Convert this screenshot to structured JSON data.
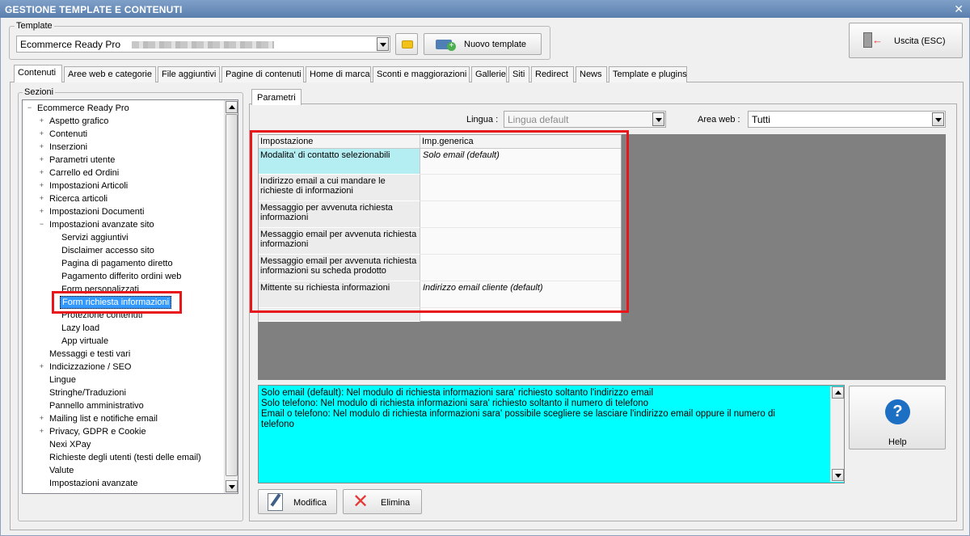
{
  "window": {
    "title": "GESTIONE TEMPLATE E CONTENUTI"
  },
  "template": {
    "group_label": "Template",
    "selected": "Ecommerce Ready Pro",
    "new_button": "Nuovo template"
  },
  "exit_button": "Uscita (ESC)",
  "tabs": [
    "Contenuti",
    "Aree web e categorie",
    "File aggiuntivi",
    "Pagine di contenuti",
    "Home di marca",
    "Sconti e maggiorazioni",
    "Gallerie",
    "Siti",
    "Redirect",
    "News",
    "Template e plugins"
  ],
  "sections": {
    "label": "Sezioni",
    "root": "Ecommerce Ready Pro",
    "items": [
      "Aspetto grafico",
      "Contenuti",
      "Inserzioni",
      "Parametri utente",
      "Carrello ed Ordini",
      "Impostazioni Articoli",
      "Ricerca articoli",
      "Impostazioni Documenti",
      "Impostazioni avanzate sito"
    ],
    "subitems": [
      "Servizi aggiuntivi",
      "Disclaimer accesso sito",
      "Pagina di pagamento diretto",
      "Pagamento differito ordini web",
      "Form personalizzati",
      "Form richiesta informazioni",
      "Protezione contenuti",
      "Lazy load",
      "App virtuale"
    ],
    "items_after": [
      "Messaggi e testi vari",
      "Indicizzazione / SEO",
      "Lingue",
      "Stringhe/Traduzioni",
      "Pannello amministrativo",
      "Mailing list e notifiche email",
      "Privacy, GDPR e Cookie",
      "Nexi XPay",
      "Richieste degli utenti (testi delle email)",
      "Valute",
      "Impostazioni avanzate"
    ]
  },
  "params": {
    "tab_label": "Parametri",
    "lingua_label": "Lingua :",
    "lingua_value": "Lingua default",
    "area_label": "Area web :",
    "area_value": "Tutti",
    "col_setting": "Impostazione",
    "col_value": "Imp.generica",
    "rows": [
      {
        "name": "Modalita' di contatto selezionabili",
        "value": "Solo email (default)"
      },
      {
        "name": "Indirizzo email a cui mandare le richieste di informazioni",
        "value": ""
      },
      {
        "name": "Messaggio per avvenuta richiesta informazioni",
        "value": ""
      },
      {
        "name": "Messaggio email per avvenuta richiesta informazioni",
        "value": ""
      },
      {
        "name": "Messaggio email per avvenuta richiesta informazioni su scheda prodotto",
        "value": ""
      },
      {
        "name": "Mittente su richiesta informazioni",
        "value": "Indirizzo email cliente (default)"
      }
    ]
  },
  "description": {
    "line1": "Solo email (default): Nel modulo di richiesta informazioni sara' richiesto soltanto l'indirizzo email",
    "line2": "Solo telefono: Nel modulo di richiesta informazioni sara' richiesto soltanto il numero di telefono",
    "line3": "Email o telefono: Nel modulo di richiesta informazioni sara' possibile scegliere se lasciare l'indirizzo email oppure il numero di telefono"
  },
  "help_button": "Help",
  "modify_button": "Modifica",
  "delete_button": "Elimina",
  "colors": {
    "highlight_red": "#e8161b",
    "desc_bg": "#00ffff",
    "selected_row": "#b5eef2",
    "help_blue": "#1d6fc4"
  }
}
